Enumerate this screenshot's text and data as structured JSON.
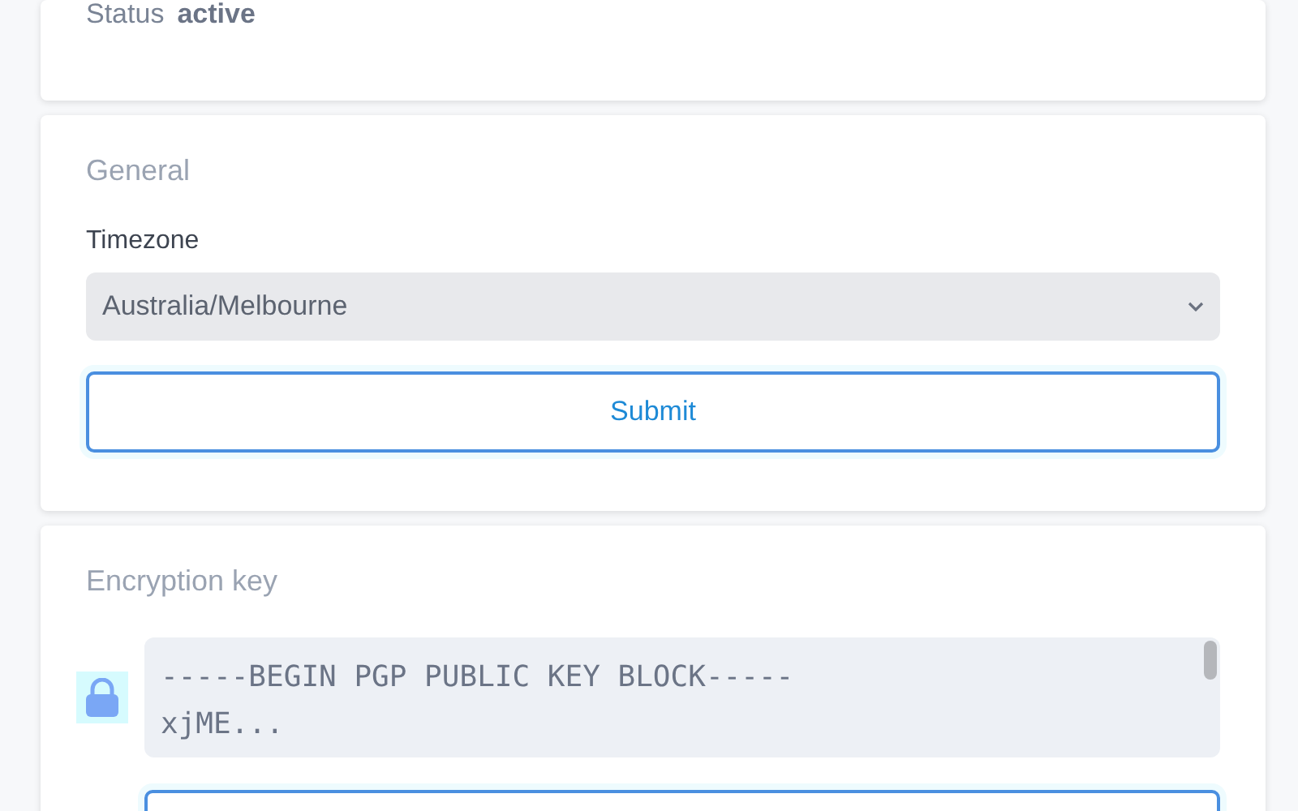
{
  "status": {
    "label": "Status",
    "value": "active"
  },
  "general": {
    "title": "General",
    "timezone_label": "Timezone",
    "timezone_value": "Australia/Melbourne",
    "submit": "Submit"
  },
  "encryption": {
    "title": "Encryption key",
    "key_text": "-----BEGIN PGP PUBLIC KEY BLOCK-----\nxjME..."
  }
}
